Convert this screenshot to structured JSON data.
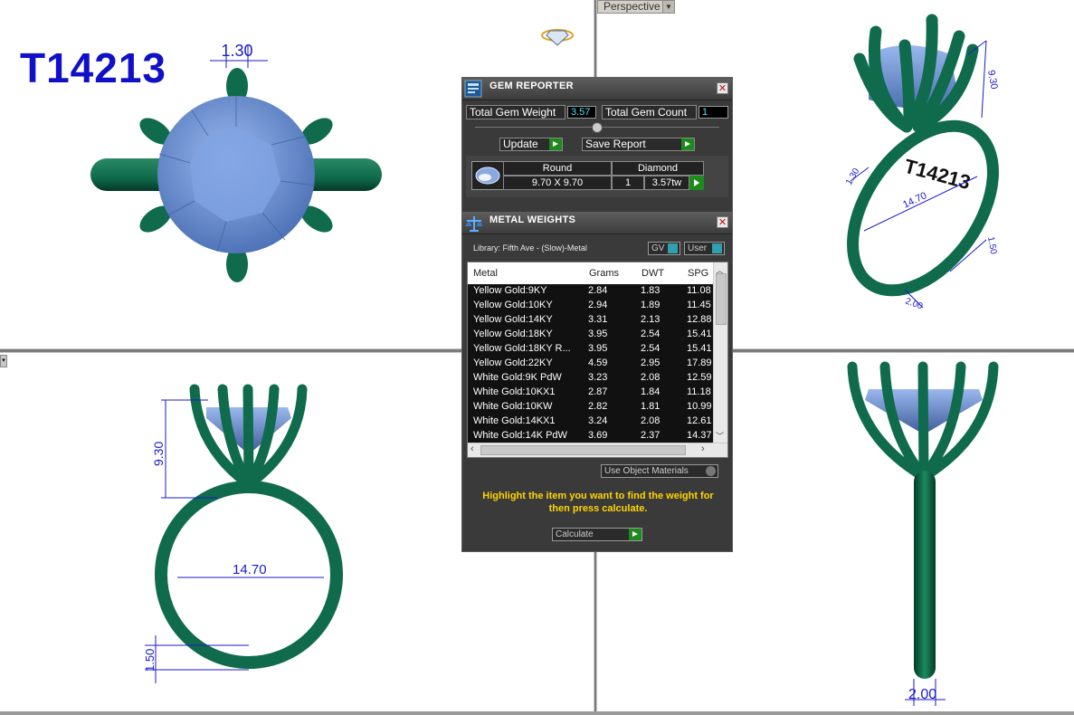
{
  "model_code": "T14213",
  "viewport_label": "Perspective",
  "dimensions": {
    "top_prong_width": "1.30",
    "top_right_height": "9.30",
    "top_right_diameter": "14.70",
    "top_right_band": "1.50",
    "top_right_band_w": "2.00",
    "top_right_small": "1.30",
    "front_height": "9.30",
    "front_diameter": "14.70",
    "front_band": "1.50",
    "side_width": "2.00"
  },
  "engraving": "T14213",
  "gem_reporter": {
    "title": "GEM REPORTER",
    "total_weight_label": "Total Gem Weight",
    "total_weight_value": "3.57",
    "total_count_label": "Total Gem Count",
    "total_count_value": "1",
    "update_label": "Update",
    "save_label": "Save Report",
    "gem": {
      "shape": "Round",
      "type": "Diamond",
      "size": "9.70 X 9.70",
      "count": "1",
      "weight": "3.57tw"
    }
  },
  "metal_weights": {
    "title": "METAL WEIGHTS",
    "library": "Library: Fifth Ave - (Slow)-Metal",
    "gv_label": "GV",
    "user_label": "User",
    "columns": [
      "Metal",
      "Grams",
      "DWT",
      "SPG"
    ],
    "rows": [
      {
        "metal": "Yellow Gold:9KY",
        "grams": "2.84",
        "dwt": "1.83",
        "spg": "11.08"
      },
      {
        "metal": "Yellow Gold:10KY",
        "grams": "2.94",
        "dwt": "1.89",
        "spg": "11.45"
      },
      {
        "metal": "Yellow Gold:14KY",
        "grams": "3.31",
        "dwt": "2.13",
        "spg": "12.88"
      },
      {
        "metal": "Yellow Gold:18KY",
        "grams": "3.95",
        "dwt": "2.54",
        "spg": "15.41"
      },
      {
        "metal": "Yellow Gold:18KY R...",
        "grams": "3.95",
        "dwt": "2.54",
        "spg": "15.41"
      },
      {
        "metal": "Yellow Gold:22KY",
        "grams": "4.59",
        "dwt": "2.95",
        "spg": "17.89"
      },
      {
        "metal": "White Gold:9K PdW",
        "grams": "3.23",
        "dwt": "2.08",
        "spg": "12.59"
      },
      {
        "metal": "White Gold:10KX1",
        "grams": "2.87",
        "dwt": "1.84",
        "spg": "11.18"
      },
      {
        "metal": "White Gold:10KW",
        "grams": "2.82",
        "dwt": "1.81",
        "spg": "10.99"
      },
      {
        "metal": "White Gold:14KX1",
        "grams": "3.24",
        "dwt": "2.08",
        "spg": "12.61"
      },
      {
        "metal": "White Gold:14K PdW",
        "grams": "3.69",
        "dwt": "2.37",
        "spg": "14.37"
      }
    ],
    "use_object_label": "Use Object Materials",
    "note": "Highlight the item you want to find the weight for then press calculate.",
    "calculate_label": "Calculate"
  },
  "colors": {
    "metal": "#0f6b4c",
    "gem": "#6f95d8",
    "dimension": "#1a1ad0",
    "panel_bg": "#3a3a3a",
    "note_text": "#ffd400"
  }
}
